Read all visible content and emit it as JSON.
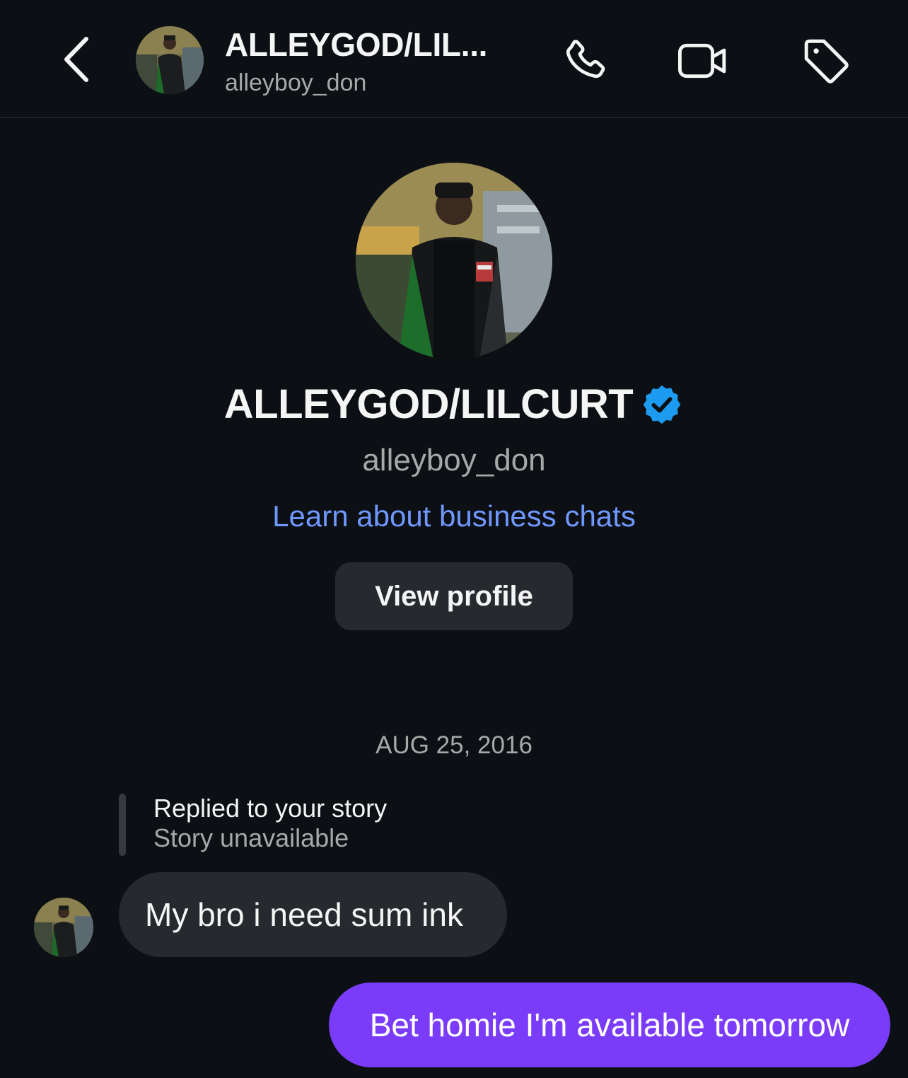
{
  "header": {
    "title": "ALLEYGOD/LIL...",
    "subtitle": "alleyboy_don",
    "icons": [
      "chevron-left-icon",
      "phone-icon",
      "video-icon",
      "tag-icon"
    ]
  },
  "profile": {
    "name": "ALLEYGOD/LILCURT",
    "handle": "alleyboy_don",
    "learn_link": "Learn about business chats",
    "view_profile_label": "View profile",
    "verified": true
  },
  "conversation": {
    "date": "AUG 25, 2016",
    "reply_context": {
      "title": "Replied to your story",
      "subtitle": "Story unavailable"
    },
    "messages": [
      {
        "direction": "incoming",
        "text": "My bro i need sum ink"
      },
      {
        "direction": "outgoing",
        "text": "Bet homie I'm available tomorrow"
      }
    ]
  },
  "colors": {
    "background": "#0c1014",
    "bubble_incoming": "#262a2e",
    "bubble_outgoing": "#7a3cf8",
    "link": "#6f97ff",
    "verified": "#1d9bf0"
  }
}
